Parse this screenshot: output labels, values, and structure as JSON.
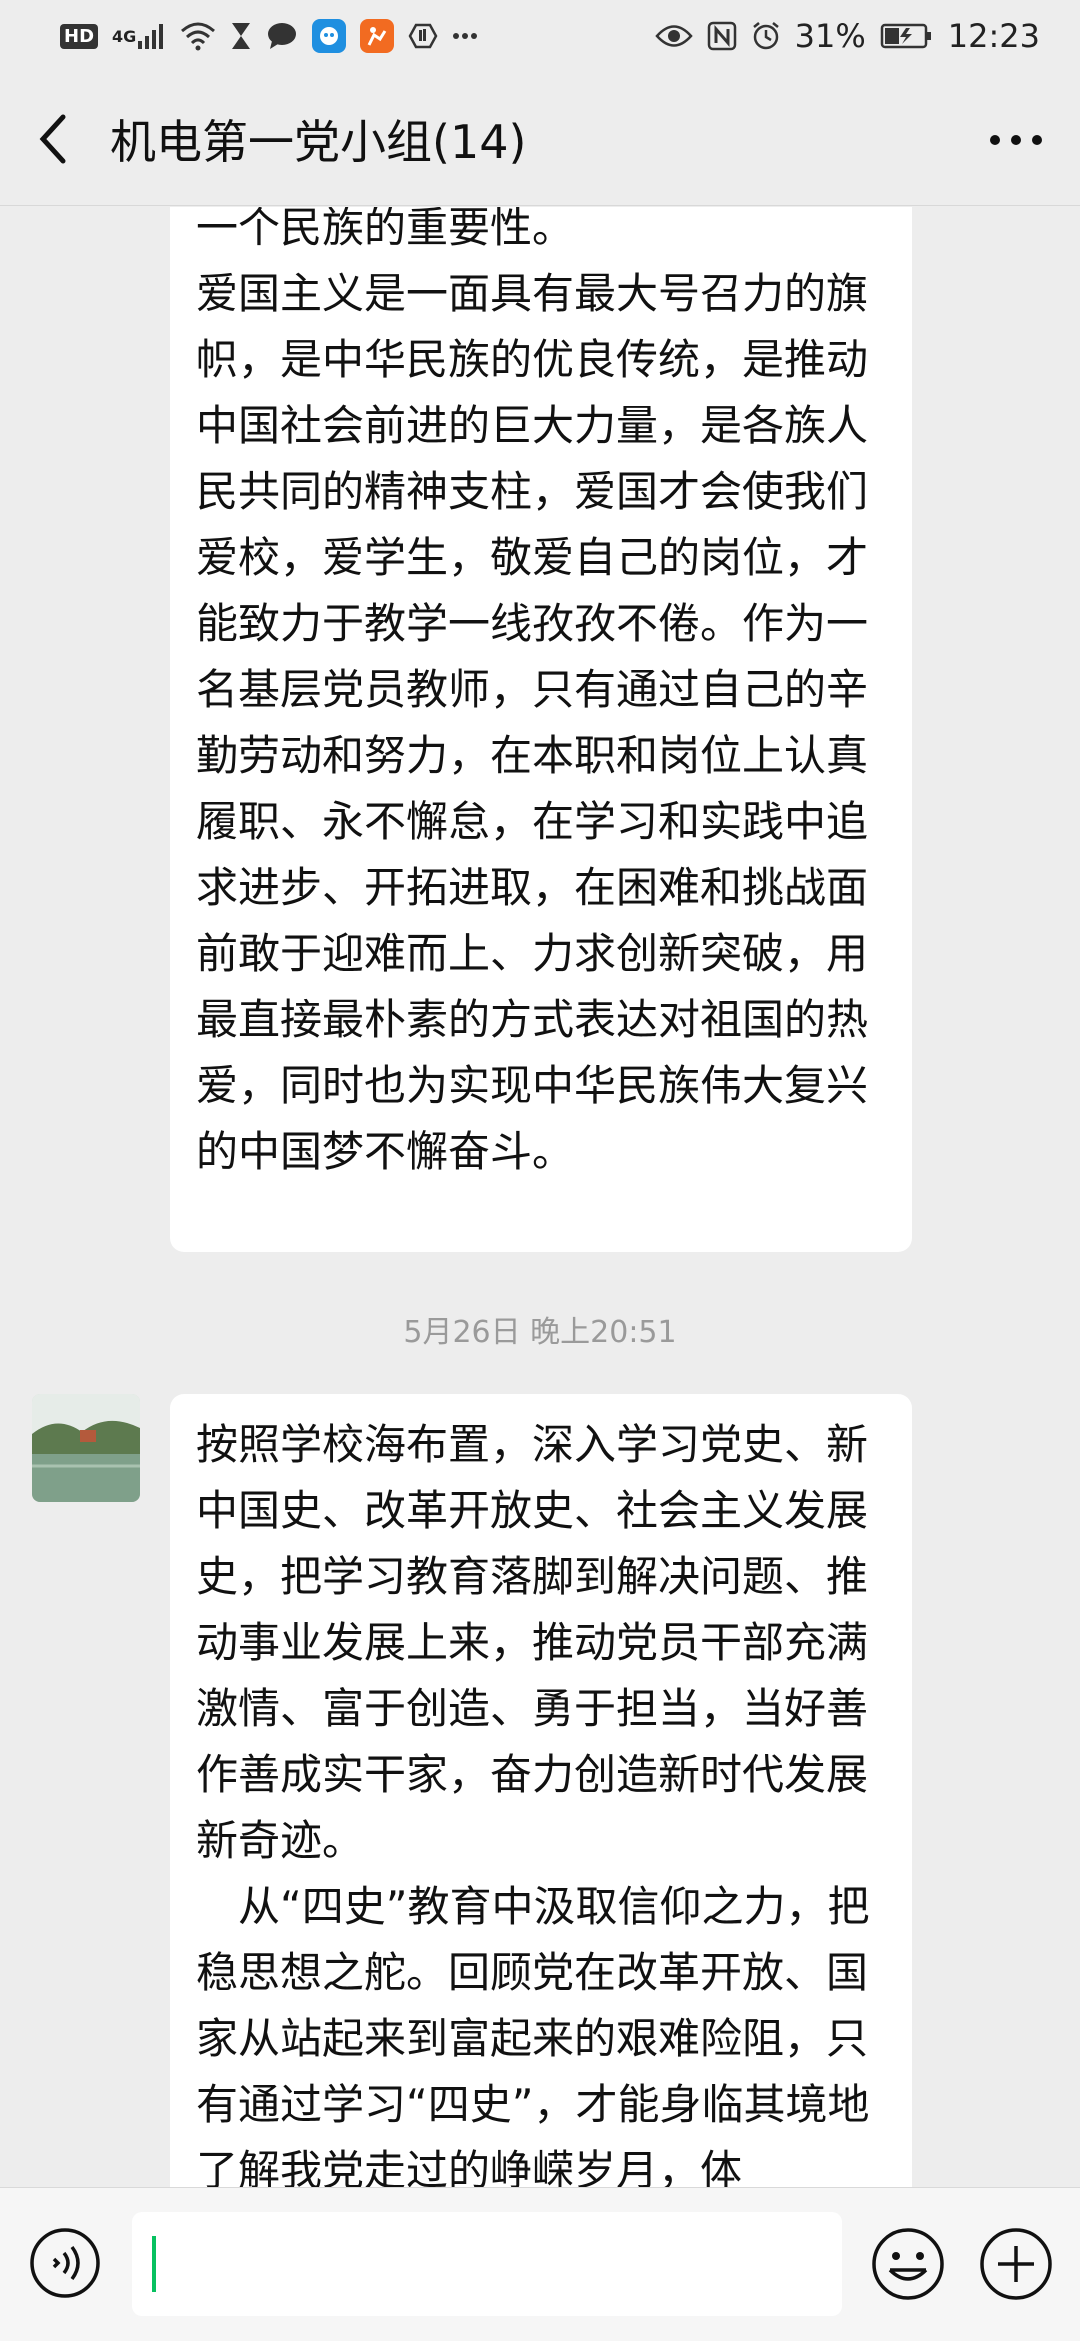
{
  "status_bar": {
    "hd_label": "HD",
    "network_label": "4G",
    "battery_percent": "31%",
    "time": "12:23",
    "icons": [
      "hd-icon",
      "signal-icon",
      "wifi-icon",
      "hourglass-icon",
      "chat-icon",
      "app-icon",
      "app-orange-icon",
      "hand-icon",
      "more-dots-icon",
      "eye-icon",
      "nfc-icon",
      "alarm-icon",
      "battery-icon"
    ]
  },
  "header": {
    "title": "机电第一党小组(14)",
    "back_icon": "back-chevron-icon",
    "more_icon": "more-icon"
  },
  "messages": [
    {
      "lines": [
        "一个民族的重要性。",
        "爱国主义是一面具有最大号召力的旗帜，是中华民族的优良传统，是推动中国社会前进的巨大力量，是各族人民共同的精神支柱，爱国才会使我们爱校，爱学生，敬爱自己的岗位，才能致力于教学一线孜孜不倦。作为一名基层党员教师，只有通过自己的辛勤劳动和努力，在本职和岗位上认真履职、永不懈怠，在学习和实践中追求进步、开拓进取，在困难和挑战面前敢于迎难而上、力求创新突破，用最直接最朴素的方式表达对祖国的热爱，同时也为实现中华民族伟大复兴的中国梦不懈奋斗。"
      ]
    },
    {
      "timestamp": "5月26日 晚上20:51",
      "lines": [
        "按照学校海布置，深入学习党史、新中国史、改革开放史、社会主义发展史，把学习教育落脚到解决问题、推动事业发展上来，推动党员干部充满激情、富于创造、勇于担当，当好善作善成实干家，奋力创造新时代发展新奇迹。",
        "　从“四史”教育中汲取信仰之力，把稳思想之舵。回顾党在改革开放、国家从站起来到富起来的艰难险阻，只有通过学习“四史”，才能身临其境地了解我党走过的峥嵘岁月，体"
      ]
    }
  ],
  "input_bar": {
    "voice_icon": "voice-icon",
    "emoji_icon": "emoji-icon",
    "plus_icon": "plus-icon",
    "text": ""
  },
  "colors": {
    "background": "#ededed",
    "bubble": "#ffffff",
    "caret": "#07c160"
  }
}
